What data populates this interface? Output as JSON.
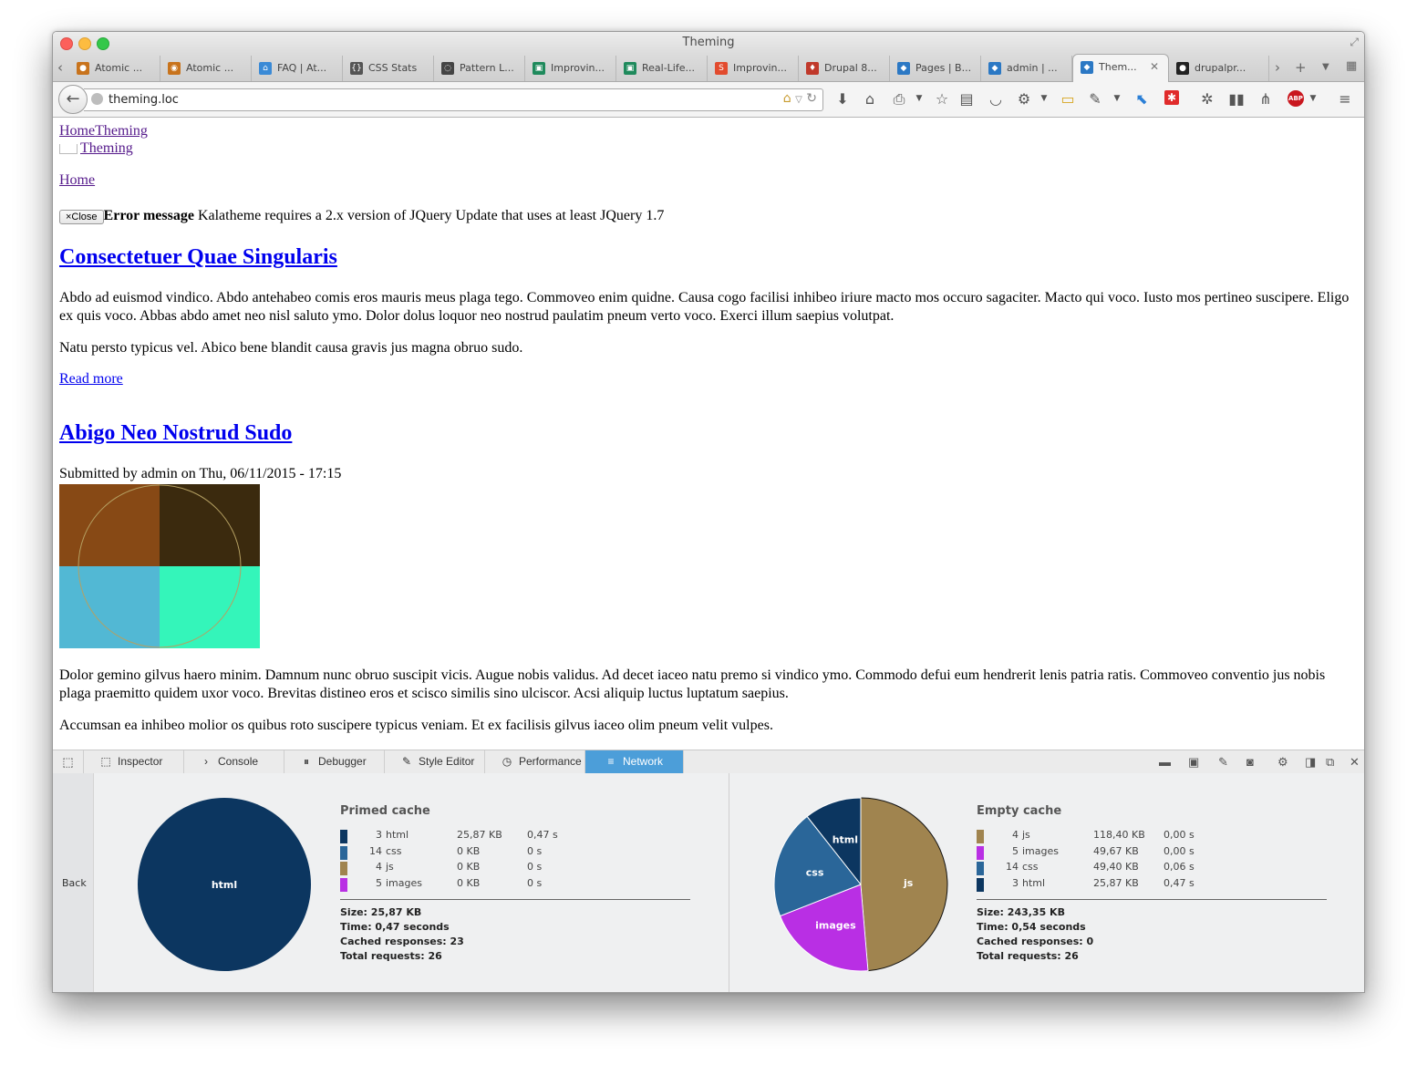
{
  "window": {
    "title": "Theming"
  },
  "tabs": [
    {
      "label": "Atomic ...",
      "icon": "atomic-icon",
      "color": "#c8731c"
    },
    {
      "label": "Atomic ...",
      "icon": "atomic-ring-icon",
      "color": "#c8731c"
    },
    {
      "label": "FAQ | At...",
      "icon": "house-icon",
      "color": "#3a8ad6"
    },
    {
      "label": "CSS Stats",
      "icon": "braces-icon",
      "color": "#555555"
    },
    {
      "label": "Pattern L...",
      "icon": "spinner-icon",
      "color": "#444444"
    },
    {
      "label": "Improvin...",
      "icon": "slide-icon",
      "color": "#1f8a5c"
    },
    {
      "label": "Real-Life...",
      "icon": "slide-icon",
      "color": "#1f8a5c"
    },
    {
      "label": "Improvin...",
      "icon": "speakerdeck-icon",
      "color": "#e24b2e"
    },
    {
      "label": "Drupal 8...",
      "icon": "drupal-red-icon",
      "color": "#c0392b"
    },
    {
      "label": "Pages | B...",
      "icon": "drupal-icon",
      "color": "#2b78c4"
    },
    {
      "label": "admin | ...",
      "icon": "drupal-icon",
      "color": "#2b78c4"
    },
    {
      "label": "Them...",
      "icon": "drupal-icon",
      "color": "#2b78c4",
      "active": true
    },
    {
      "label": "drupalpr...",
      "icon": "github-icon",
      "color": "#222222"
    }
  ],
  "navbar": {
    "url": "theming.loc"
  },
  "page": {
    "breadcrumb_home": "Home",
    "breadcrumb_theming": "Theming",
    "menu_theming": "Theming",
    "home_link": "Home",
    "close_label": "×Close",
    "error_label": "Error message",
    "error_text": "Kalatheme requires a 2.x version of JQuery Update that uses at least JQuery 1.7",
    "node1": {
      "title": "Consectetuer Quae Singularis",
      "p1": "Abdo ad euismod vindico. Abdo antehabeo comis eros mauris meus plaga tego. Commoveo enim quidne. Causa cogo facilisi inhibeo iriure macto mos occuro sagaciter. Macto qui voco. Iusto mos pertineo suscipere. Eligo ex quis voco. Abbas abdo amet neo nisl saluto ymo. Dolor dolus loquor neo nostrud paulatim pneum verto voco. Exerci illum saepius volutpat.",
      "p2": "Natu persto typicus vel. Abico bene blandit causa gravis jus magna obruo sudo.",
      "read_more": "Read more"
    },
    "node2": {
      "title": "Abigo Neo Nostrud Sudo",
      "submitted": "Submitted by admin on Thu, 06/11/2015 - 17:15",
      "image_colors": [
        "#874915",
        "#3b2a0e",
        "#52b8d4",
        "#34f5ba"
      ],
      "p1": "Dolor gemino gilvus haero minim. Damnum nunc obruo suscipit vicis. Augue nobis validus. Ad decet iaceo natu premo si vindico ymo. Commodo defui eum hendrerit lenis patria ratis. Commoveo conventio jus nobis plaga praemitto quidem uxor voco. Brevitas distineo eros et scisco similis sino ulciscor. Acsi aliquip luctus luptatum saepius.",
      "p2": "Accumsan ea inhibeo molior os quibus roto suscipere typicus veniam. Et ex facilisis gilvus iaceo olim pneum velit vulpes."
    }
  },
  "devtools": {
    "tabs": [
      {
        "label": "Inspector",
        "icon": "inspector-icon"
      },
      {
        "label": "Console",
        "icon": "console-icon"
      },
      {
        "label": "Debugger",
        "icon": "debugger-icon"
      },
      {
        "label": "Style Editor",
        "icon": "style-editor-icon"
      },
      {
        "label": "Performance",
        "icon": "performance-icon"
      },
      {
        "label": "Network",
        "icon": "network-icon",
        "active": true
      }
    ],
    "back_label": "Back",
    "primed": {
      "title": "Primed cache",
      "rows": [
        {
          "count": "3",
          "type": "html",
          "size": "25,87 KB",
          "time": "0,47 s",
          "color": "#0c3660"
        },
        {
          "count": "14",
          "type": "css",
          "size": "0 KB",
          "time": "0 s",
          "color": "#2a6699"
        },
        {
          "count": "4",
          "type": "js",
          "size": "0 KB",
          "time": "0 s",
          "color": "#a0844f"
        },
        {
          "count": "5",
          "type": "images",
          "size": "0 KB",
          "time": "0 s",
          "color": "#b92fe4"
        }
      ],
      "size": "Size: 25,87 KB",
      "time": "Time: 0,47 seconds",
      "cached": "Cached responses: 23",
      "total": "Total requests: 26"
    },
    "empty": {
      "title": "Empty cache",
      "rows": [
        {
          "count": "4",
          "type": "js",
          "size": "118,40 KB",
          "time": "0,00 s",
          "color": "#a0844f"
        },
        {
          "count": "5",
          "type": "images",
          "size": "49,67 KB",
          "time": "0,00 s",
          "color": "#b92fe4"
        },
        {
          "count": "14",
          "type": "css",
          "size": "49,40 KB",
          "time": "0,06 s",
          "color": "#2a6699"
        },
        {
          "count": "3",
          "type": "html",
          "size": "25,87 KB",
          "time": "0,47 s",
          "color": "#0c3660"
        }
      ],
      "size": "Size: 243,35 KB",
      "time": "Time: 0,54 seconds",
      "cached": "Cached responses: 0",
      "total": "Total requests: 26"
    }
  },
  "chart_data": [
    {
      "type": "pie",
      "categories": [
        "html"
      ],
      "values": [
        25.87
      ]
    },
    {
      "type": "pie",
      "categories": [
        "js",
        "images",
        "css",
        "html"
      ],
      "values": [
        118.4,
        49.67,
        49.4,
        25.87
      ]
    }
  ]
}
